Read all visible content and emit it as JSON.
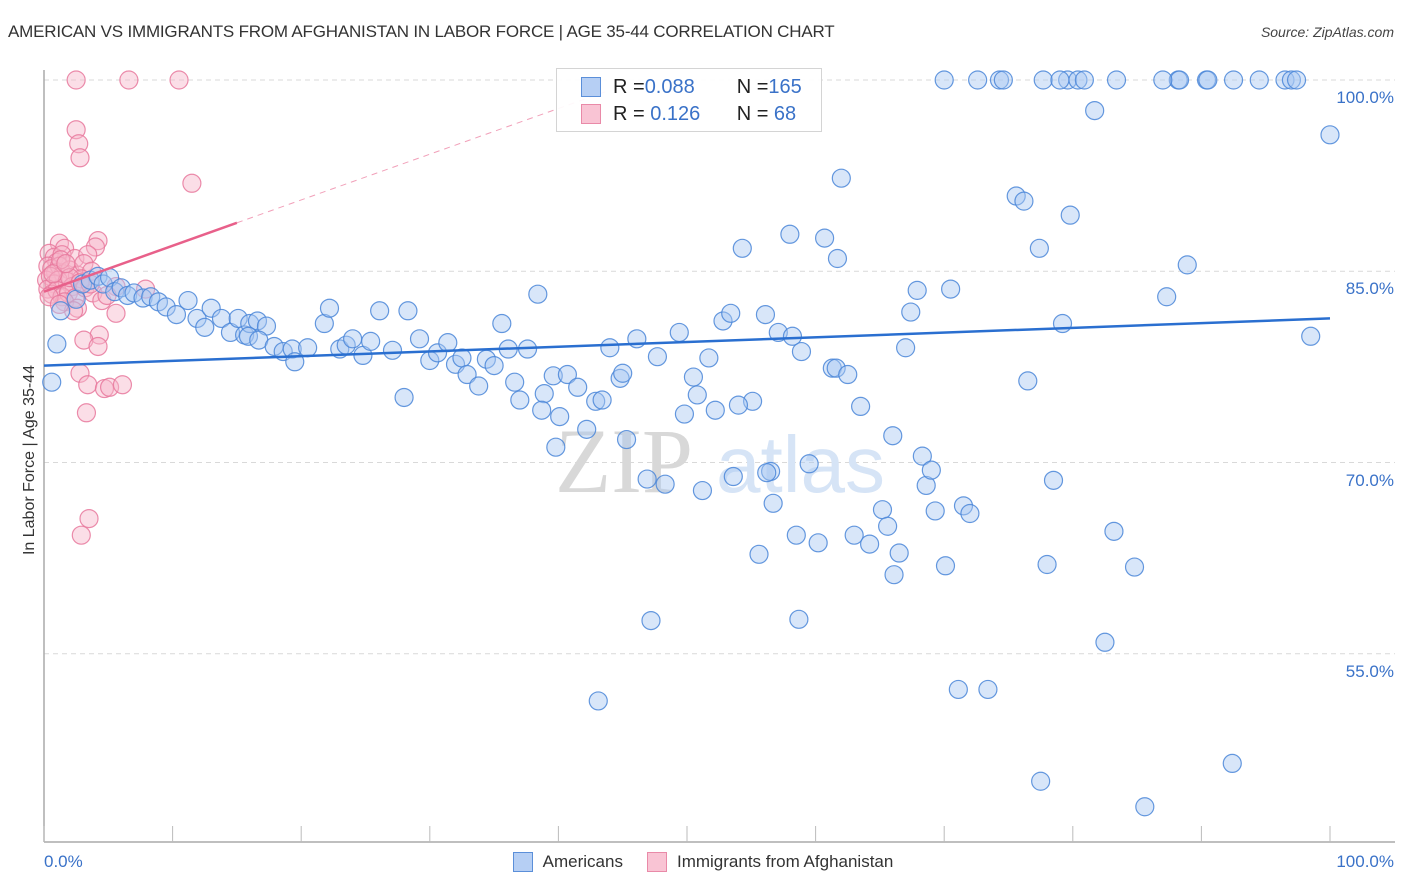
{
  "title": "AMERICAN VS IMMIGRANTS FROM AFGHANISTAN IN LABOR FORCE | AGE 35-44 CORRELATION CHART",
  "source": "Source: ZipAtlas.com",
  "watermark": {
    "part1": "ZIP",
    "part2": "atlas"
  },
  "legend": {
    "rows": [
      {
        "r_label": "R = ",
        "r_value": "0.088",
        "n_label": "N = ",
        "n_value": "165"
      },
      {
        "r_label": "R = ",
        "r_value": " 0.126",
        "n_label": "N = ",
        "n_value": " 68"
      }
    ]
  },
  "bottom_legend": [
    "Americans",
    "Immigrants from Afghanistan"
  ],
  "colors": {
    "americans_fill": "#a9c8f2",
    "americans_stroke": "#4a86d8",
    "americans_line": "#2a6fd0",
    "afghan_fill": "#f7b6ca",
    "afghan_stroke": "#e8789c",
    "afghan_line": "#e8608a",
    "tick_label": "#3a72c8",
    "grid": "#d9d9d9"
  },
  "chart_data": {
    "type": "scatter",
    "title": "AMERICAN VS IMMIGRANTS FROM AFGHANISTAN IN LABOR FORCE | AGE 35-44 CORRELATION CHART",
    "xlabel": "",
    "ylabel": "In Labor Force | Age 35-44",
    "xlim": [
      0,
      100
    ],
    "ylim": [
      41.5,
      100.5
    ],
    "x_tick_labels": [
      "0.0%",
      "100.0%"
    ],
    "y_ticks": [
      100,
      85,
      70,
      55
    ],
    "y_tick_labels": [
      "100.0%",
      "85.0%",
      "70.0%",
      "55.0%"
    ],
    "grid": true,
    "legend_position": "top-center",
    "series": [
      {
        "name": "Americans",
        "R": 0.088,
        "N": 165,
        "trend": {
          "x": [
            0,
            100
          ],
          "y": [
            77.6,
            81.3
          ]
        },
        "points": [
          [
            0.6,
            76.3
          ],
          [
            1.0,
            79.3
          ],
          [
            1.3,
            81.9
          ],
          [
            2.5,
            82.8
          ],
          [
            3.0,
            84.0
          ],
          [
            3.6,
            84.3
          ],
          [
            4.2,
            84.6
          ],
          [
            4.6,
            84.0
          ],
          [
            5.1,
            84.5
          ],
          [
            5.5,
            83.4
          ],
          [
            6.0,
            83.7
          ],
          [
            6.5,
            83.1
          ],
          [
            7.0,
            83.3
          ],
          [
            7.7,
            82.9
          ],
          [
            8.3,
            83.0
          ],
          [
            8.9,
            82.6
          ],
          [
            9.5,
            82.2
          ],
          [
            10.3,
            81.6
          ],
          [
            11.2,
            82.7
          ],
          [
            11.9,
            81.3
          ],
          [
            12.5,
            80.6
          ],
          [
            13.0,
            82.1
          ],
          [
            13.8,
            81.3
          ],
          [
            14.5,
            80.2
          ],
          [
            15.1,
            81.3
          ],
          [
            15.6,
            80.0
          ],
          [
            16.0,
            80.9
          ],
          [
            16.6,
            81.1
          ],
          [
            17.3,
            80.7
          ],
          [
            15.9,
            79.9
          ],
          [
            16.7,
            79.6
          ],
          [
            17.9,
            79.1
          ],
          [
            18.6,
            78.7
          ],
          [
            19.3,
            78.9
          ],
          [
            19.5,
            77.9
          ],
          [
            20.5,
            79.0
          ],
          [
            21.8,
            80.9
          ],
          [
            22.2,
            82.1
          ],
          [
            23.0,
            78.9
          ],
          [
            23.5,
            79.2
          ],
          [
            24.0,
            79.7
          ],
          [
            24.8,
            78.4
          ],
          [
            25.4,
            79.5
          ],
          [
            26.1,
            81.9
          ],
          [
            27.1,
            78.8
          ],
          [
            28.0,
            75.1
          ],
          [
            28.3,
            81.9
          ],
          [
            29.2,
            79.7
          ],
          [
            30.0,
            78.0
          ],
          [
            30.6,
            78.6
          ],
          [
            31.4,
            79.4
          ],
          [
            32.0,
            77.7
          ],
          [
            32.5,
            78.2
          ],
          [
            32.9,
            76.9
          ],
          [
            33.8,
            76.0
          ],
          [
            34.4,
            78.1
          ],
          [
            35.0,
            77.6
          ],
          [
            35.6,
            80.9
          ],
          [
            36.1,
            78.9
          ],
          [
            36.6,
            76.3
          ],
          [
            37.6,
            78.9
          ],
          [
            37.0,
            74.9
          ],
          [
            38.4,
            83.2
          ],
          [
            38.9,
            75.4
          ],
          [
            39.6,
            76.8
          ],
          [
            38.7,
            74.1
          ],
          [
            40.1,
            73.6
          ],
          [
            39.8,
            71.2
          ],
          [
            40.7,
            76.9
          ],
          [
            41.5,
            75.9
          ],
          [
            42.2,
            72.6
          ],
          [
            42.9,
            74.8
          ],
          [
            43.4,
            74.9
          ],
          [
            44.0,
            79.0
          ],
          [
            44.8,
            76.6
          ],
          [
            45.0,
            77.0
          ],
          [
            45.3,
            71.8
          ],
          [
            46.1,
            79.7
          ],
          [
            46.9,
            68.7
          ],
          [
            47.7,
            78.3
          ],
          [
            48.3,
            68.3
          ],
          [
            49.4,
            80.2
          ],
          [
            49.8,
            73.8
          ],
          [
            50.5,
            76.7
          ],
          [
            50.8,
            75.3
          ],
          [
            51.2,
            67.8
          ],
          [
            51.7,
            78.2
          ],
          [
            52.2,
            74.1
          ],
          [
            52.8,
            81.1
          ],
          [
            53.4,
            81.7
          ],
          [
            53.6,
            68.9
          ],
          [
            54.3,
            86.8
          ],
          [
            55.1,
            74.8
          ],
          [
            55.6,
            62.8
          ],
          [
            56.1,
            81.6
          ],
          [
            56.5,
            69.3
          ],
          [
            56.7,
            66.8
          ],
          [
            57.1,
            80.2
          ],
          [
            58.0,
            87.9
          ],
          [
            58.5,
            64.3
          ],
          [
            58.2,
            79.9
          ],
          [
            58.9,
            78.7
          ],
          [
            59.5,
            69.9
          ],
          [
            60.2,
            63.7
          ],
          [
            60.7,
            87.6
          ],
          [
            61.3,
            77.4
          ],
          [
            61.6,
            77.4
          ],
          [
            62.0,
            92.3
          ],
          [
            62.5,
            76.9
          ],
          [
            63.0,
            64.3
          ],
          [
            63.5,
            74.4
          ],
          [
            64.2,
            63.6
          ],
          [
            65.2,
            66.3
          ],
          [
            65.6,
            65.0
          ],
          [
            66.0,
            72.1
          ],
          [
            66.5,
            62.9
          ],
          [
            67.0,
            79.0
          ],
          [
            67.4,
            81.8
          ],
          [
            67.9,
            83.5
          ],
          [
            68.3,
            70.5
          ],
          [
            68.6,
            68.2
          ],
          [
            69.3,
            66.2
          ],
          [
            70.1,
            61.9
          ],
          [
            70.5,
            83.6
          ],
          [
            71.1,
            52.2
          ],
          [
            71.5,
            66.6
          ],
          [
            72.0,
            66.0
          ],
          [
            70.0,
            100
          ],
          [
            72.6,
            100
          ],
          [
            74.3,
            100
          ],
          [
            74.6,
            100
          ],
          [
            75.6,
            90.9
          ],
          [
            76.2,
            90.5
          ],
          [
            76.5,
            76.4
          ],
          [
            77.4,
            86.8
          ],
          [
            77.7,
            100
          ],
          [
            78.5,
            68.6
          ],
          [
            79.2,
            80.9
          ],
          [
            79.8,
            89.4
          ],
          [
            79.6,
            100
          ],
          [
            80.4,
            100
          ],
          [
            80.9,
            100
          ],
          [
            82.5,
            55.9
          ],
          [
            83.2,
            64.6
          ],
          [
            83.4,
            100
          ],
          [
            84.8,
            61.8
          ],
          [
            87.3,
            83.0
          ],
          [
            88.2,
            100
          ],
          [
            88.3,
            100
          ],
          [
            88.9,
            85.5
          ],
          [
            90.4,
            100
          ],
          [
            90.5,
            100
          ],
          [
            92.4,
            46.4
          ],
          [
            92.5,
            100
          ],
          [
            94.5,
            100
          ],
          [
            98.5,
            79.9
          ],
          [
            96.5,
            100
          ],
          [
            97.0,
            100
          ],
          [
            97.4,
            100
          ],
          [
            100,
            95.7
          ],
          [
            85.6,
            43.0
          ],
          [
            77.5,
            45.0
          ],
          [
            58.7,
            57.7
          ],
          [
            81.7,
            97.6
          ],
          [
            43.1,
            51.3
          ],
          [
            73.4,
            52.2
          ],
          [
            54.0,
            74.5
          ],
          [
            47.2,
            57.6
          ],
          [
            56.2,
            69.2
          ],
          [
            61.7,
            86.0
          ],
          [
            78.0,
            62.0
          ],
          [
            66.1,
            61.2
          ],
          [
            69.0,
            69.4
          ],
          [
            79.0,
            100
          ],
          [
            87.0,
            100
          ]
        ]
      },
      {
        "name": "Immigrants from Afghanistan",
        "R": 0.126,
        "N": 68,
        "trend": {
          "x": [
            0,
            15
          ],
          "y": [
            83.4,
            88.8
          ],
          "extended": {
            "x": [
              15,
              44
            ],
            "y": [
              88.8,
              99.2
            ]
          }
        },
        "points": [
          [
            2.5,
            100
          ],
          [
            6.6,
            100
          ],
          [
            10.5,
            100
          ],
          [
            2.5,
            96.1
          ],
          [
            2.7,
            95.0
          ],
          [
            2.8,
            93.9
          ],
          [
            11.5,
            91.9
          ],
          [
            4.2,
            87.4
          ],
          [
            1.2,
            87.2
          ],
          [
            1.6,
            86.8
          ],
          [
            4.0,
            86.9
          ],
          [
            0.4,
            86.4
          ],
          [
            0.8,
            86.1
          ],
          [
            1.0,
            85.7
          ],
          [
            1.4,
            86.3
          ],
          [
            2.4,
            86.0
          ],
          [
            3.4,
            86.3
          ],
          [
            0.3,
            85.4
          ],
          [
            0.6,
            85.2
          ],
          [
            0.9,
            84.9
          ],
          [
            1.2,
            85.4
          ],
          [
            1.5,
            84.8
          ],
          [
            2.0,
            85.1
          ],
          [
            2.6,
            84.7
          ],
          [
            3.1,
            85.6
          ],
          [
            3.7,
            85.0
          ],
          [
            0.2,
            84.3
          ],
          [
            0.5,
            84.6
          ],
          [
            0.8,
            84.0
          ],
          [
            1.1,
            84.3
          ],
          [
            1.8,
            84.2
          ],
          [
            2.2,
            83.8
          ],
          [
            2.9,
            84.4
          ],
          [
            0.3,
            83.6
          ],
          [
            0.6,
            83.2
          ],
          [
            1.0,
            83.5
          ],
          [
            1.4,
            83.0
          ],
          [
            1.9,
            83.3
          ],
          [
            2.4,
            82.9
          ],
          [
            3.2,
            83.7
          ],
          [
            3.8,
            83.3
          ],
          [
            4.5,
            82.7
          ],
          [
            5.6,
            83.8
          ],
          [
            7.9,
            83.6
          ],
          [
            1.6,
            82.6
          ],
          [
            2.6,
            82.1
          ],
          [
            2.3,
            81.9
          ],
          [
            5.6,
            81.7
          ],
          [
            4.3,
            80.0
          ],
          [
            3.1,
            79.6
          ],
          [
            4.2,
            79.1
          ],
          [
            2.8,
            77.0
          ],
          [
            3.4,
            76.1
          ],
          [
            4.7,
            75.8
          ],
          [
            5.1,
            75.9
          ],
          [
            6.1,
            76.1
          ],
          [
            3.3,
            73.9
          ],
          [
            3.5,
            65.6
          ],
          [
            2.9,
            64.3
          ],
          [
            2.0,
            84.5
          ],
          [
            1.3,
            85.9
          ],
          [
            0.7,
            84.8
          ],
          [
            2.8,
            84.1
          ],
          [
            1.7,
            85.6
          ],
          [
            3.6,
            84.0
          ],
          [
            0.4,
            83.0
          ],
          [
            1.2,
            82.4
          ],
          [
            4.9,
            83.1
          ]
        ]
      }
    ]
  }
}
